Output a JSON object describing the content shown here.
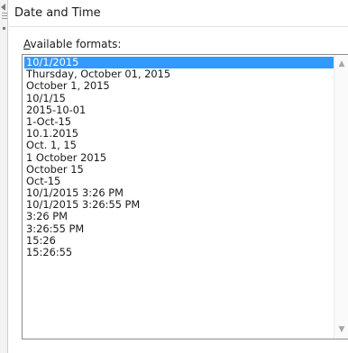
{
  "dialog": {
    "title": "Date and Time",
    "available_label_prefix": "A",
    "available_label_rest": "vailable formats:"
  },
  "formats": {
    "selected_index": 0,
    "items": [
      "10/1/2015",
      "Thursday, October 01, 2015",
      "October 1, 2015",
      "10/1/15",
      "2015-10-01",
      "1-Oct-15",
      "10.1.2015",
      "Oct. 1, 15",
      "1 October 2015",
      "October 15",
      "Oct-15",
      "10/1/2015 3:26 PM",
      "10/1/2015 3:26:55 PM",
      "3:26 PM",
      "3:26:55 PM",
      "15:26",
      "15:26:55"
    ]
  },
  "icons": {
    "scroll_up": "chevron-up-icon",
    "scroll_down": "chevron-down-icon"
  },
  "colors": {
    "selection": "#3399ff"
  }
}
